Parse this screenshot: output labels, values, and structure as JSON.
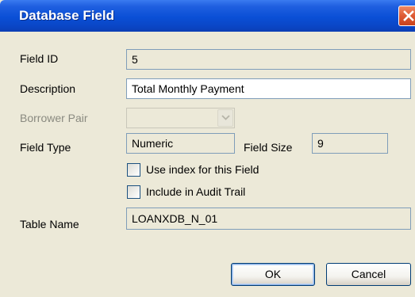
{
  "window": {
    "title": "Database Field"
  },
  "form": {
    "field_id": {
      "label": "Field ID",
      "value": "5"
    },
    "description": {
      "label": "Description",
      "value": "Total Monthly Payment"
    },
    "borrower_pair": {
      "label": "Borrower Pair",
      "value": ""
    },
    "field_type": {
      "label": "Field Type",
      "value": "Numeric"
    },
    "field_size": {
      "label": "Field Size",
      "value": "9"
    },
    "use_index": {
      "label": "Use index for this Field",
      "checked": false
    },
    "audit_trail": {
      "label": "Include in Audit Trail",
      "checked": false
    },
    "table_name": {
      "label": "Table Name",
      "value": "LOANXDB_N_01"
    }
  },
  "buttons": {
    "ok": "OK",
    "cancel": "Cancel"
  },
  "icons": {
    "close": "close-icon",
    "dropdown": "chevron-down-icon"
  },
  "colors": {
    "title_bar": "#0a4fd6",
    "dialog_bg": "#ece9d8",
    "close_button": "#de5a34"
  }
}
